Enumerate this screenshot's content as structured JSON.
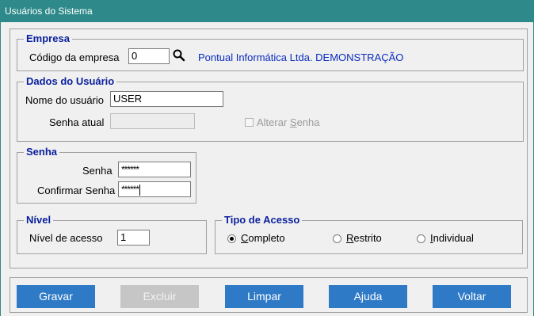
{
  "window": {
    "title": "Usuários do Sistema"
  },
  "empresa": {
    "legend": "Empresa",
    "code_label": "Código da empresa",
    "code_value": "0",
    "company_name": "Pontual Informática Ltda. DEMONSTRAÇÃO"
  },
  "usuario": {
    "legend": "Dados do Usuário",
    "name_label": "Nome do usuário",
    "name_value": "USER",
    "current_password_label": "Senha atual",
    "current_password_value": "",
    "alterar_prefix": "Alterar ",
    "alterar_accel": "S",
    "alterar_suffix": "enha",
    "alterar_checked": false
  },
  "senha": {
    "legend": "Senha",
    "password_label": "Senha",
    "password_value": "******",
    "confirm_label": "Confirmar Senha",
    "confirm_value": "******"
  },
  "nivel": {
    "legend": "Nível",
    "level_label": "Nível de acesso",
    "level_value": "1"
  },
  "tipo_acesso": {
    "legend": "Tipo de Acesso",
    "options": [
      {
        "accel": "C",
        "rest": "ompleto",
        "selected": true
      },
      {
        "accel": "R",
        "rest": "estrito",
        "selected": false
      },
      {
        "accel": "I",
        "rest": "ndividual",
        "selected": false
      }
    ]
  },
  "buttons": {
    "gravar": "Gravar",
    "excluir": "Excluir",
    "limpar": "Limpar",
    "ajuda": "Ajuda",
    "voltar": "Voltar"
  },
  "colors": {
    "titlebar": "#2e8a8a",
    "legend_text": "#0a1f9e",
    "company_text": "#0a2cc0",
    "button_bg": "#2f7ac6",
    "button_disabled_bg": "#c6c6c6"
  },
  "icons": {
    "search": "magnifier-icon"
  }
}
